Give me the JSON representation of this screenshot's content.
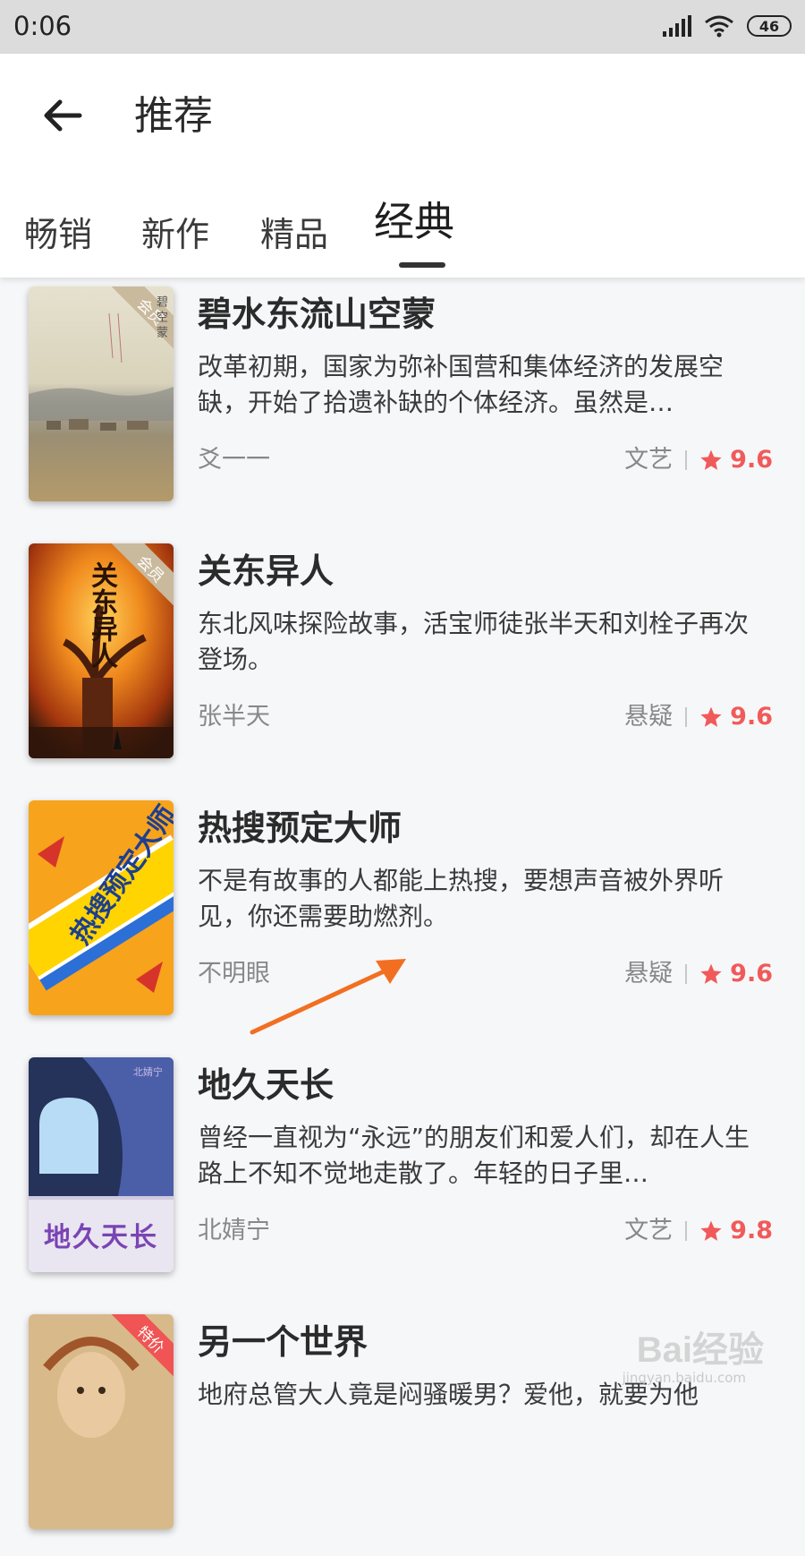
{
  "status_bar": {
    "time": "0:06",
    "battery": "46"
  },
  "header": {
    "title": "推荐"
  },
  "tabs": [
    {
      "label": "畅销",
      "active": false
    },
    {
      "label": "新作",
      "active": false
    },
    {
      "label": "精品",
      "active": false
    },
    {
      "label": "经典",
      "active": true
    }
  ],
  "books": [
    {
      "title": "碧水东流山空蒙",
      "description": "改革初期，国家为弥补国营和集体经济的发展空缺，开始了拾遗补缺的个体经济。虽然是…",
      "author": "爻一一",
      "genre": "文艺",
      "rating": "9.6",
      "badge": "会员",
      "cover_text": "碧 空 蒙"
    },
    {
      "title": "关东异人",
      "description": "东北风味探险故事，活宝师徒张半天和刘栓子再次登场。",
      "author": "张半天",
      "genre": "悬疑",
      "rating": "9.6",
      "badge": "会员",
      "cover_text": "关东异人"
    },
    {
      "title": "热搜预定大师",
      "description": "不是有故事的人都能上热搜，要想声音被外界听见，你还需要助燃剂。",
      "author": "不明眼",
      "genre": "悬疑",
      "rating": "9.6",
      "badge": "",
      "cover_text": "热搜预定大师"
    },
    {
      "title": "地久天长",
      "description": "曾经一直视为“永远”的朋友们和爱人们，却在人生路上不知不觉地走散了。年轻的日子里…",
      "author": "北婧宁",
      "genre": "文艺",
      "rating": "9.8",
      "badge": "",
      "cover_text": "地久天长",
      "cover_author": "北婧宁"
    },
    {
      "title": "另一个世界",
      "description": "地府总管大人竟是闷骚暖男？爱他，就要为他",
      "author": "",
      "genre": "",
      "rating": "",
      "badge": "特价",
      "cover_text": ""
    }
  ],
  "watermark": {
    "text": "Bai经验",
    "sub": "jingyan.baidu.com"
  },
  "colors": {
    "rating": "#f15a5a",
    "header_bg": "#ffffff",
    "list_bg": "#f6f7f8"
  }
}
